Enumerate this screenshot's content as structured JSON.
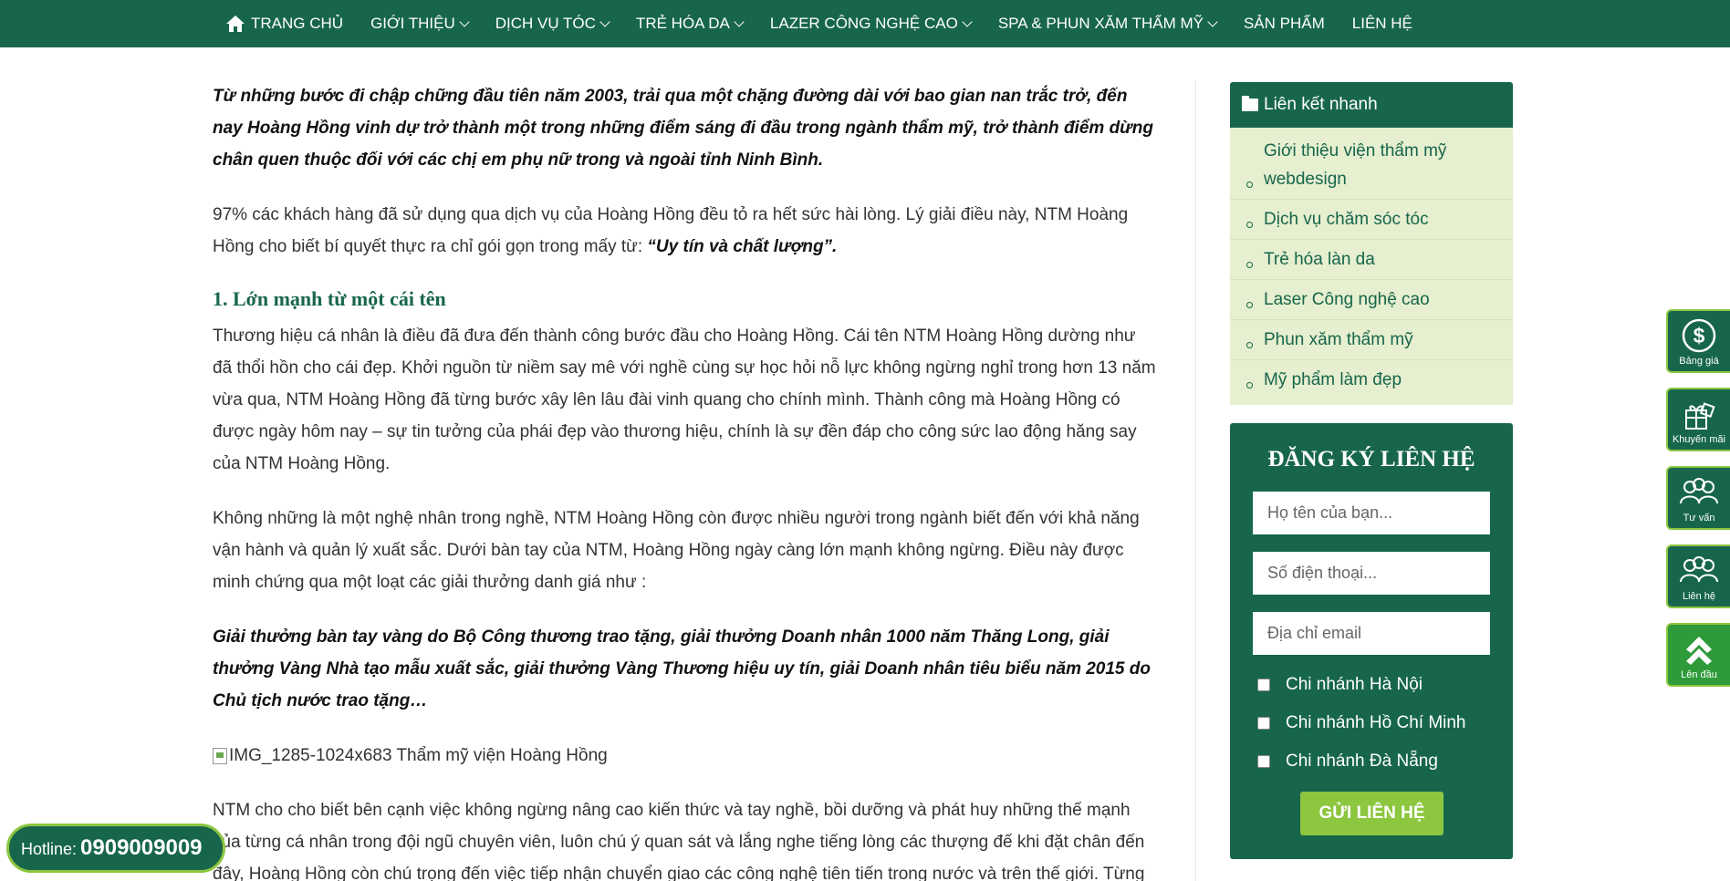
{
  "nav": {
    "items": [
      {
        "label": "TRANG CHỦ",
        "has_icon": "home-icon"
      },
      {
        "label": "GIỚI THIỆU",
        "dropdown": true
      },
      {
        "label": "DỊCH VỤ TÓC",
        "dropdown": true
      },
      {
        "label": "TRẺ HÓA DA",
        "dropdown": true
      },
      {
        "label": "LAZER CÔNG NGHỆ CAO",
        "dropdown": true
      },
      {
        "label": "SPA & PHUN XĂM THẨM MỸ",
        "dropdown": true
      },
      {
        "label": "SẢN PHẨM"
      },
      {
        "label": "LIÊN HỆ"
      }
    ]
  },
  "article": {
    "intro": "Từ những bước đi chập chững đầu tiên năm 2003, trải qua một chặng đường dài với bao gian nan trắc trở, đến nay Hoàng Hồng vinh dự trở thành một trong những điểm sáng đi đầu trong ngành thẩm mỹ, trở thành điểm dừng chân quen thuộc đối với các chị em phụ nữ trong và ngoài tỉnh Ninh Bình.",
    "p1": "97% các khách hàng đã sử dụng qua dịch vụ của Hoàng Hồng đều tỏ ra hết sức hài lòng. Lý giải điều này, NTM Hoàng Hồng cho biết bí quyết thực ra chỉ gói gọn trong mấy từ: ",
    "p1_quote": "“Uy tín và chất lượng”.",
    "h2": "1. Lớn mạnh từ một cái tên",
    "p2": "Thương hiệu cá nhân là điều đã đưa đến thành công bước đầu cho Hoàng Hồng. Cái tên NTM Hoàng Hồng dường như đã thổi hồn cho cái đẹp. Khởi nguồn từ niềm say mê với nghề cùng sự học hỏi nỗ lực không ngừng nghỉ trong hơn 13 năm vừa qua, NTM Hoàng Hồng đã từng bước xây lên lâu đài vinh quang cho chính mình. Thành công mà Hoàng Hồng có được ngày hôm nay – sự tin tưởng của phái đẹp vào thương hiệu, chính là sự đền đáp cho công sức lao động hăng say của NTM Hoàng Hồng.",
    "p3": "Không những là một nghệ nhân trong nghề, NTM Hoàng Hồng còn được nhiều người trong ngành biết đến với khả năng vận hành và quản lý xuất sắc. Dưới bàn tay của NTM, Hoàng Hồng ngày càng lớn mạnh không ngừng. Điều này được minh chứng qua một loạt các giải thưởng danh giá như :",
    "awards": "Giải thưởng bàn tay vàng do Bộ Công thương trao tặng, giải thưởng Doanh nhân 1000 năm Thăng Long, giải thưởng Vàng Nhà tạo mẫu xuất sắc, giải thưởng Vàng Thương hiệu uy tín, giải Doanh nhân tiêu biểu năm 2015 do Chủ tịch nước trao tặng…",
    "image_alt": "IMG_1285-1024x683 Thẩm mỹ viện Hoàng Hồng",
    "p4": "NTM cho cho biết bên cạnh việc không ngừng nâng cao kiến thức và tay nghề, bồi dưỡng và phát huy những thế mạnh của từng cá nhân trong đội ngũ chuyên viên, luôn chú ý quan sát và lắng nghe tiếng lòng các thượng đế khi đặt chân đến đây, Hoàng Hồng còn chú trọng đến việc tiếp nhận chuyển giao các công nghệ tiên tiến trong nước và trên thế giới. Từng"
  },
  "sidebar": {
    "quick_title": "Liên kết nhanh",
    "quick_links": [
      "Giới thiệu viện thẩm mỹ webdesign",
      "Dịch vụ chăm sóc tóc",
      "Trẻ hóa làn da",
      "Laser Công nghệ cao",
      "Phun xăm thẩm mỹ",
      "Mỹ phẩm làm đẹp"
    ],
    "register": {
      "title": "ĐĂNG KÝ LIÊN HỆ",
      "name_placeholder": "Họ tên của bạn...",
      "phone_placeholder": "Số điện thoại...",
      "email_placeholder": "Địa chỉ email",
      "branches": [
        "Chi nhánh Hà Nội",
        "Chi nhánh Hồ Chí Minh",
        "Chi nhánh Đà Nẵng"
      ],
      "submit": "GỬI LIÊN HỆ"
    }
  },
  "floating": [
    {
      "label": "Bảng giá",
      "icon": "dollar-icon"
    },
    {
      "label": "Khuyến mãi",
      "icon": "gift-icon"
    },
    {
      "label": "Tư vấn",
      "icon": "people-icon"
    },
    {
      "label": "Liên hệ",
      "icon": "people-icon"
    },
    {
      "label": "Lên đầu",
      "icon": "double-chevron-up-icon"
    }
  ],
  "hotline": {
    "label": "Hotline:",
    "number": "0909009009"
  },
  "colors": {
    "primary": "#17664c",
    "accent": "#8dc63f",
    "quick_bg": "#e6efcf"
  }
}
